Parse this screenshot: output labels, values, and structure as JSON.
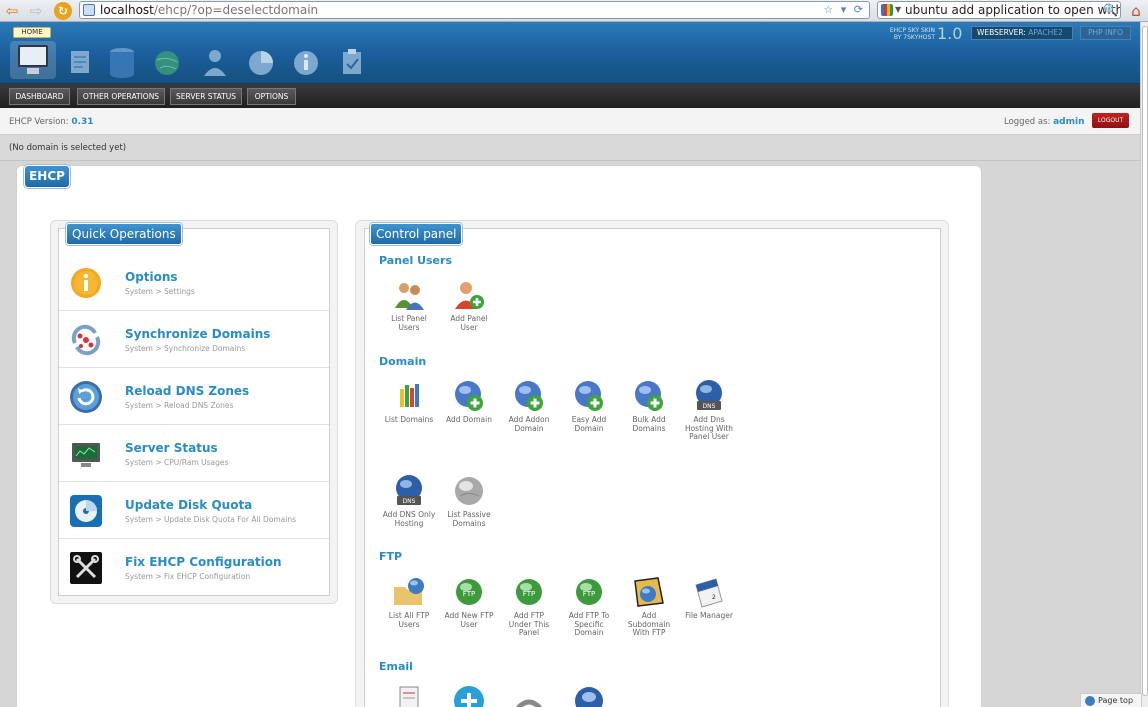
{
  "browser": {
    "url_host": "localhost",
    "url_path": "/ehcp/?op=deselectdomain",
    "search_text": "ubuntu add application to open with menu"
  },
  "header": {
    "home_label": "HOME",
    "skin_line1": "EHCP SKY SKIN",
    "skin_line2": "BY 7SKYHOST",
    "skin_version": "1.0",
    "webserver_label": "WEBSERVER:",
    "webserver_value": "APACHE2",
    "phpinfo_label": "PHP INFO"
  },
  "menu": {
    "items": [
      "DASHBOARD",
      "OTHER OPERATIONS",
      "SERVER STATUS",
      "OPTIONS"
    ]
  },
  "info": {
    "version_label": "EHCP Version:",
    "version_value": "0.31",
    "logged_label": "Logged as:",
    "logged_user": "admin",
    "logout_label": "LOGOUT"
  },
  "domain_status": "(No domain is selected yet)",
  "main_tab": "EHCP",
  "quick_ops": {
    "title": "Quick Operations",
    "items": [
      {
        "title": "Options",
        "sub": "System > Settings",
        "icon": "info-icon"
      },
      {
        "title": "Synchronize Domains",
        "sub": "System > Synchronize Domains",
        "icon": "sync-icon"
      },
      {
        "title": "Reload DNS Zones",
        "sub": "System > Reload DNS Zones",
        "icon": "reload-icon"
      },
      {
        "title": "Server Status",
        "sub": "System > CPU/Ram Usages",
        "icon": "monitor-icon"
      },
      {
        "title": "Update Disk Quota",
        "sub": "System > Update Disk Quota For All Domains",
        "icon": "disk-icon"
      },
      {
        "title": "Fix EHCP Configuration",
        "sub": "System > Fix EHCP Configuration",
        "icon": "tools-icon"
      }
    ]
  },
  "control_panel": {
    "title": "Control panel",
    "sections": {
      "panel_users": {
        "title": "Panel Users",
        "items": [
          {
            "l1": "List Panel",
            "l2": "Users",
            "l3": "",
            "icon": "users-icon"
          },
          {
            "l1": "Add Panel",
            "l2": "User",
            "l3": "",
            "icon": "add-user-icon"
          }
        ]
      },
      "domain": {
        "title": "Domain",
        "items": [
          {
            "l1": "List Domains",
            "l2": "",
            "l3": "",
            "icon": "list-icon"
          },
          {
            "l1": "Add Domain",
            "l2": "",
            "l3": "",
            "icon": "globe-add-icon"
          },
          {
            "l1": "Add Addon",
            "l2": "Domain",
            "l3": "",
            "icon": "globe-add-icon"
          },
          {
            "l1": "Easy Add",
            "l2": "Domain",
            "l3": "",
            "icon": "globe-add-icon"
          },
          {
            "l1": "Bulk Add",
            "l2": "Domains",
            "l3": "",
            "icon": "globe-add-icon"
          },
          {
            "l1": "Add Dns",
            "l2": "Hosting With",
            "l3": "Panel User",
            "icon": "dns-globe-icon"
          },
          {
            "l1": "Add DNS Only",
            "l2": "Hosting",
            "l3": "",
            "icon": "dns-globe-icon"
          },
          {
            "l1": "List Passive",
            "l2": "Domains",
            "l3": "",
            "icon": "grey-globe-icon"
          }
        ]
      },
      "ftp": {
        "title": "FTP",
        "items": [
          {
            "l1": "List All FTP",
            "l2": "Users",
            "l3": "",
            "icon": "folder-globe-icon"
          },
          {
            "l1": "Add New FTP",
            "l2": "User",
            "l3": "",
            "icon": "ftp-globe-icon"
          },
          {
            "l1": "Add FTP",
            "l2": "Under This",
            "l3": "Panel",
            "icon": "ftp-globe-icon"
          },
          {
            "l1": "Add FTP To",
            "l2": "Specific",
            "l3": "Domain",
            "icon": "ftp-globe-icon"
          },
          {
            "l1": "Add",
            "l2": "Subdomain",
            "l3": "With FTP",
            "icon": "folder-globe-icon"
          },
          {
            "l1": "File Manager",
            "l2": "",
            "l3": "",
            "icon": "file-manager-icon"
          }
        ]
      },
      "email": {
        "title": "Email",
        "items": [
          {
            "icon": "document-icon"
          },
          {
            "icon": "plus-circle-icon"
          },
          {
            "icon": "link-icon"
          },
          {
            "icon": "mail-user-icon"
          }
        ]
      }
    }
  },
  "page_top": "Page top",
  "colors": {
    "accent": "#2a8cc7",
    "header_blue": "#1a5d9a",
    "logout_red": "#b11a1a"
  }
}
